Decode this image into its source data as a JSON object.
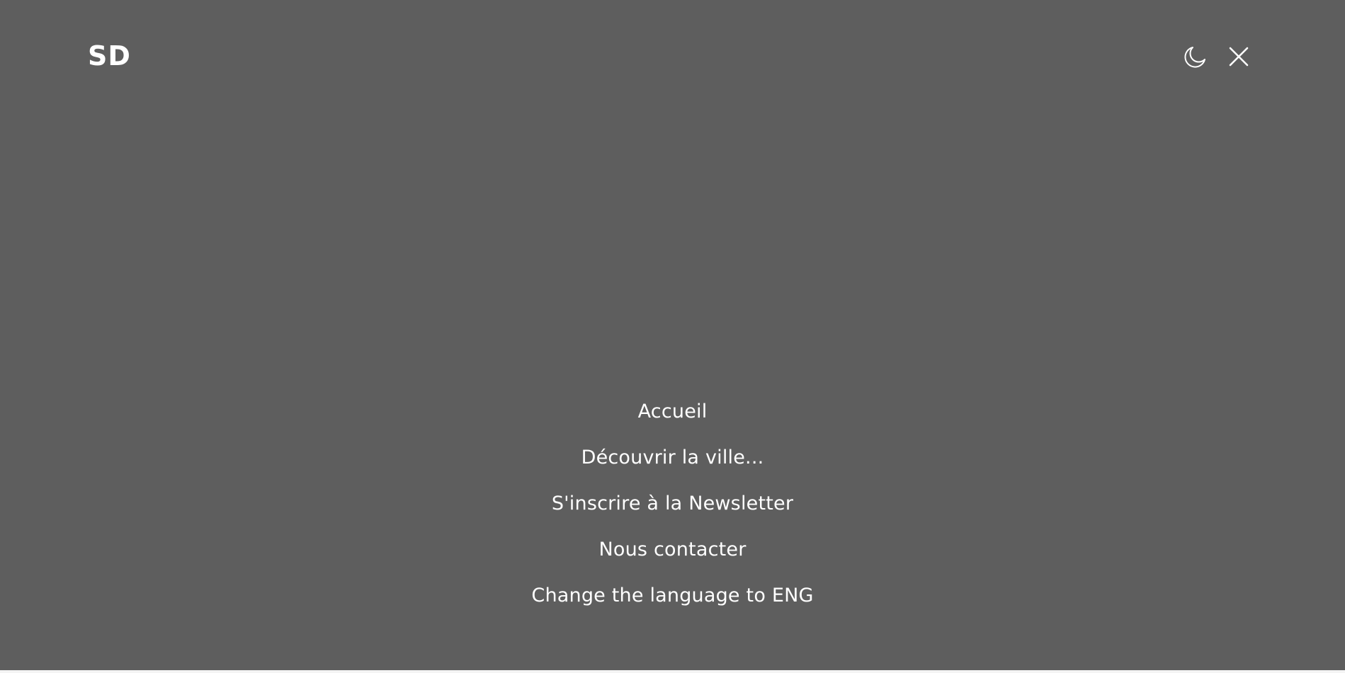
{
  "header": {
    "logo_text": "SD",
    "theme_toggle_icon": "moon-icon",
    "close_icon": "close-icon"
  },
  "menu": {
    "items": [
      {
        "label": "Accueil"
      },
      {
        "label": "Découvrir la ville..."
      },
      {
        "label": "S'inscrire à la Newsletter"
      },
      {
        "label": "Nous contacter"
      },
      {
        "label": "Change the language to ENG"
      }
    ]
  },
  "colors": {
    "overlay_background": "#5e5e5e",
    "text": "#ffffff"
  }
}
